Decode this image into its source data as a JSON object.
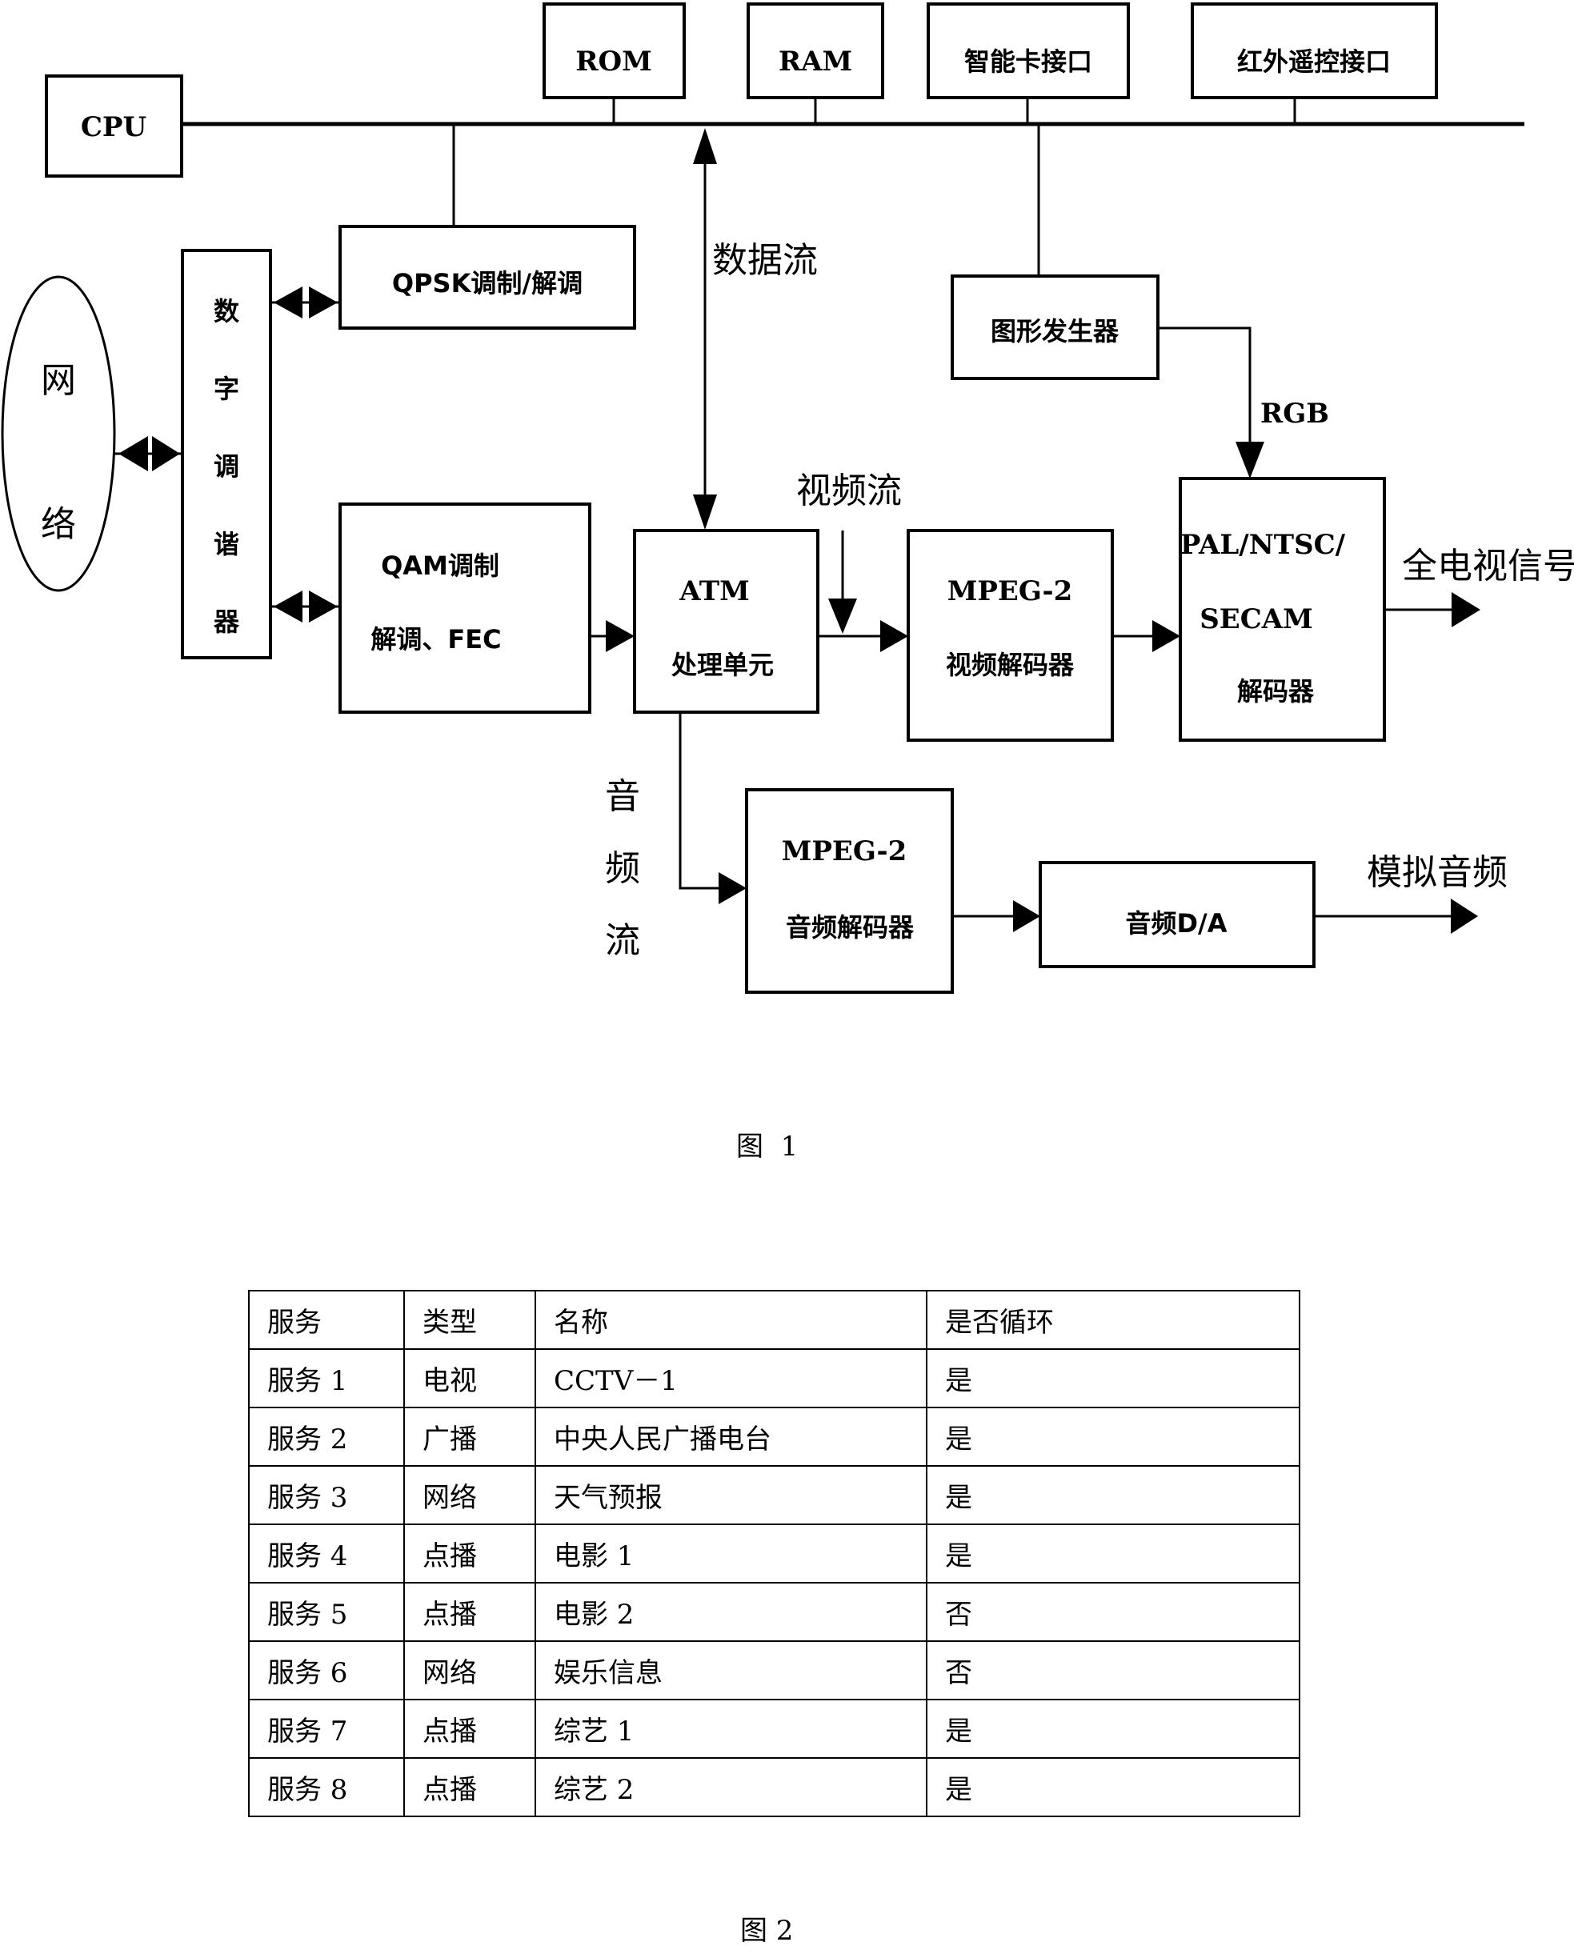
{
  "figure1": {
    "caption": "图  1",
    "blocks": {
      "cpu": "CPU",
      "rom": "ROM",
      "ram": "RAM",
      "smartcard": "智能卡接口",
      "infrared": "红外遥控接口",
      "network": [
        "网",
        "络"
      ],
      "tuner": [
        "数",
        "字",
        "调",
        "谐",
        "器"
      ],
      "qpsk": "QPSK调制/解调",
      "qam_line1": "QAM调制",
      "qam_line2": "解调、FEC",
      "atm_line1": "ATM",
      "atm_line2": "处理单元",
      "mpeg_video_line1": "MPEG-2",
      "mpeg_video_line2": "视频解码器",
      "graphics": "图形发生器",
      "pal_line1": "PAL/NTSC/",
      "pal_line2": "SECAM",
      "pal_line3": "解码器",
      "mpeg_audio_line1": "MPEG-2",
      "mpeg_audio_line2": "音频解码器",
      "audio_da": "音频D/A"
    },
    "labels": {
      "data_stream": "数据流",
      "video_stream": "视频流",
      "audio_stream": [
        "音",
        "频",
        "流"
      ],
      "rgb": "RGB",
      "full_tv_signal": "全电视信号",
      "analog_audio": "模拟音频"
    }
  },
  "figure2": {
    "caption": "图 2",
    "table": {
      "headers": [
        "服务",
        "类型",
        "名称",
        "是否循环"
      ],
      "rows": [
        [
          "服务 1",
          "电视",
          "CCTV－1",
          "是"
        ],
        [
          "服务 2",
          "广播",
          "中央人民广播电台",
          "是"
        ],
        [
          "服务 3",
          "网络",
          "天气预报",
          "是"
        ],
        [
          "服务 4",
          "点播",
          "电影 1",
          "是"
        ],
        [
          "服务 5",
          "点播",
          "电影 2",
          "否"
        ],
        [
          "服务 6",
          "网络",
          "娱乐信息",
          "否"
        ],
        [
          "服务 7",
          "点播",
          "综艺 1",
          "是"
        ],
        [
          "服务 8",
          "点播",
          "综艺 2",
          "是"
        ]
      ]
    }
  }
}
